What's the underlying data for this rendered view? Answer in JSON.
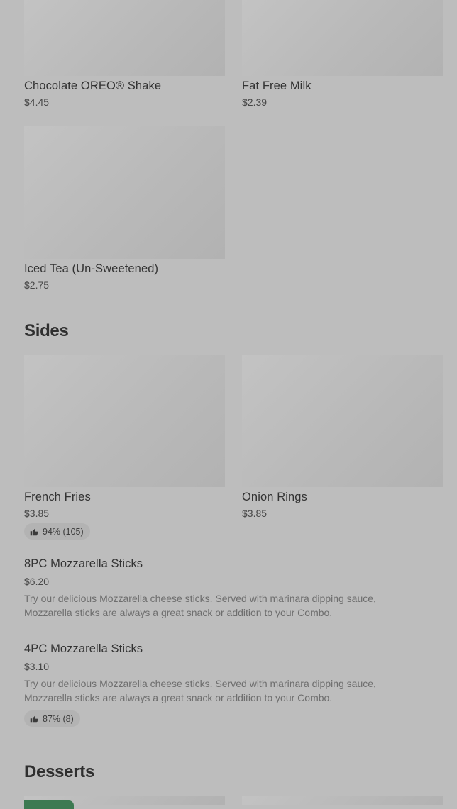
{
  "colors": {
    "background": "#bdbdbd",
    "image_placeholder": "#bababa",
    "rating_pill": "#b3b3b3",
    "promo_badge": "#3d7a52"
  },
  "drinks": {
    "items": [
      {
        "name": "Chocolate OREO® Shake",
        "price": "$4.45"
      },
      {
        "name": "Fat Free Milk",
        "price": "$2.39"
      },
      {
        "name": "Iced Tea (Un-Sweetened)",
        "price": "$2.75"
      }
    ]
  },
  "sides": {
    "title": "Sides",
    "grid": [
      {
        "name": "French Fries",
        "price": "$3.85",
        "rating": "94% (105)",
        "rating_icon": "thumbs-up-icon"
      },
      {
        "name": "Onion Rings",
        "price": "$3.85"
      }
    ],
    "list": [
      {
        "name": "8PC Mozzarella Sticks",
        "price": "$6.20",
        "description": "Try our delicious Mozzarella cheese sticks. Served with marinara dipping sauce, Mozzarella sticks are always a great snack or addition to your Combo."
      },
      {
        "name": "4PC Mozzarella Sticks",
        "price": "$3.10",
        "description": "Try our delicious Mozzarella cheese sticks. Served with marinara dipping sauce, Mozzarella sticks are always a great snack or addition to your Combo.",
        "rating": "87% (8)",
        "rating_icon": "thumbs-up-icon"
      }
    ]
  },
  "desserts": {
    "title": "Desserts"
  }
}
